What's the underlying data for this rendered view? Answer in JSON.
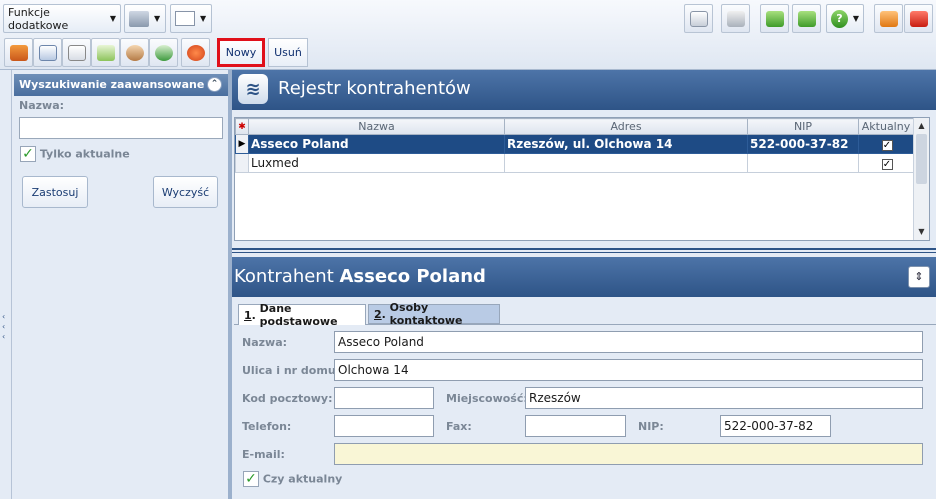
{
  "toolbar": {
    "extra_functions": "Funkcje dodatkowe",
    "new_label": "Nowy",
    "delete_label": "Usuń"
  },
  "search_panel": {
    "title": "Wyszukiwanie zaawansowane",
    "name_label": "Nazwa:",
    "name_value": "",
    "only_current_label": "Tylko aktualne",
    "only_current_checked": true,
    "apply_label": "Zastosuj",
    "clear_label": "Wyczyść"
  },
  "registry": {
    "title": "Rejestr kontrahentów",
    "columns": [
      "Nazwa",
      "Adres",
      "NIP",
      "Aktualny"
    ],
    "rows": [
      {
        "name": "Asseco Poland",
        "address": "Rzeszów, ul. Olchowa 14",
        "nip": "522-000-37-82",
        "current": true,
        "selected": true
      },
      {
        "name": "Luxmed",
        "address": "",
        "nip": "",
        "current": true,
        "selected": false
      }
    ]
  },
  "detail": {
    "title_prefix": "Kontrahent",
    "title_name": "Asseco Poland",
    "tabs": [
      {
        "key": "1",
        "label": "Dane podstawowe",
        "active": true
      },
      {
        "key": "2",
        "label": "Osoby kontaktowe",
        "active": false
      }
    ],
    "fields": {
      "name_label": "Nazwa:",
      "name_value": "Asseco Poland",
      "street_label": "Ulica i nr domu:",
      "street_value": "Olchowa 14",
      "postal_label": "Kod pocztowy:",
      "postal_value": "",
      "city_label": "Miejscowość:",
      "city_value": "Rzeszów",
      "phone_label": "Telefon:",
      "phone_value": "",
      "fax_label": "Fax:",
      "fax_value": "",
      "nip_label": "NIP:",
      "nip_value": "522-000-37-82",
      "email_label": "E-mail:",
      "email_value": "",
      "current_label": "Czy aktualny",
      "current_checked": true
    }
  },
  "colors": {
    "header_blue": "#2e5487",
    "selection": "#1e4b85",
    "highlight_red": "#e0101a"
  }
}
